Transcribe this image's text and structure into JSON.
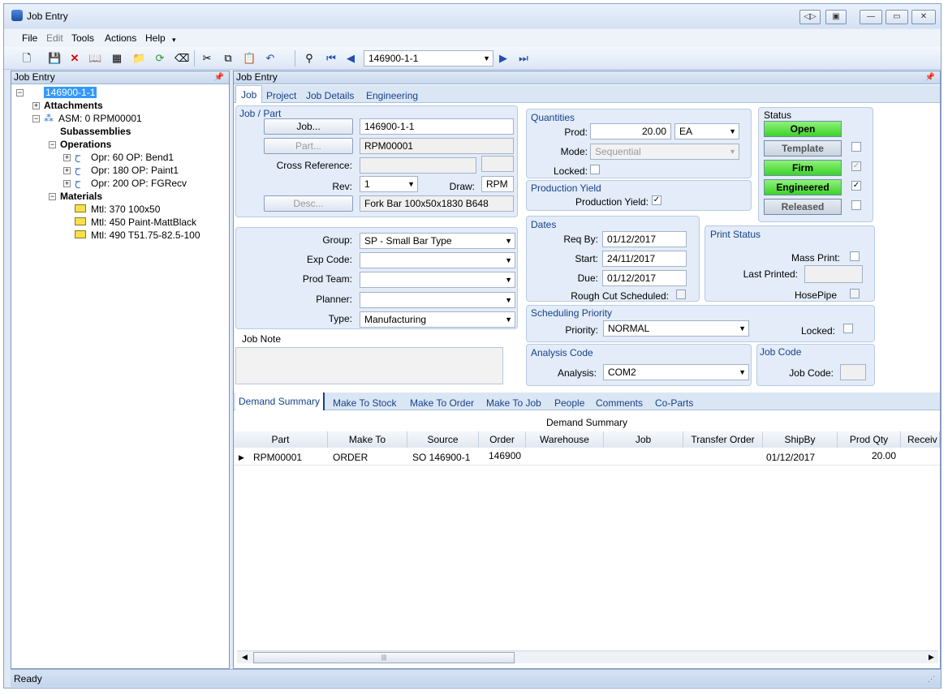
{
  "window": {
    "title": "Job Entry"
  },
  "menu": [
    "File",
    "Edit",
    "Tools",
    "Actions",
    "Help"
  ],
  "toolbar": {
    "job_combo": "146900-1-1"
  },
  "tree_panel": {
    "title": "Job Entry",
    "items": [
      {
        "label": "146900-1-1"
      },
      {
        "label": "Attachments"
      },
      {
        "label": "ASM: 0 RPM00001"
      },
      {
        "label": "Subassemblies"
      },
      {
        "label": "Operations"
      },
      {
        "label": "Opr: 60 OP: Bend1"
      },
      {
        "label": "Opr: 180 OP: Paint1"
      },
      {
        "label": "Opr: 200 OP: FGRecv"
      },
      {
        "label": "Materials"
      },
      {
        "label": "Mtl: 370 100x50"
      },
      {
        "label": "Mtl: 450 Paint-MattBlack"
      },
      {
        "label": "Mtl: 490 T51.75-82.5-100"
      }
    ]
  },
  "main": {
    "title": "Job Entry",
    "tabs": [
      "Job",
      "Project",
      "Job Details",
      "Engineering"
    ]
  },
  "job_part": {
    "title": "Job / Part",
    "job_btn": "Job...",
    "job": "146900-1-1",
    "part_btn": "Part...",
    "part": "RPM00001",
    "cross_ref_label": "Cross Reference:",
    "rev_label": "Rev:",
    "rev": "1",
    "draw_label": "Draw:",
    "draw": "RPM",
    "desc_btn": "Desc...",
    "desc": "Fork Bar 100x50x1830 B648"
  },
  "group_box": {
    "group_label": "Group:",
    "group": "SP - Small Bar Type",
    "exp_label": "Exp Code:",
    "prod_team_label": "Prod Team:",
    "planner_label": "Planner:",
    "type_label": "Type:",
    "type": "Manufacturing"
  },
  "job_note": {
    "label": "Job Note"
  },
  "quantities": {
    "title": "Quantities",
    "prod_label": "Prod:",
    "prod": "20.00",
    "uom": "EA",
    "mode_label": "Mode:",
    "mode": "Sequential",
    "locked_label": "Locked:"
  },
  "production_yield": {
    "title": "Production Yield",
    "label": "Production Yield:"
  },
  "dates": {
    "title": "Dates",
    "req_label": "Req By:",
    "req": "01/12/2017",
    "start_label": "Start:",
    "start": "24/11/2017",
    "due_label": "Due:",
    "due": "01/12/2017",
    "rough_label": "Rough Cut Scheduled:"
  },
  "status": {
    "title": "Status",
    "open": "Open",
    "template": "Template",
    "firm": "Firm",
    "engineered": "Engineered",
    "released": "Released"
  },
  "print_status": {
    "title": "Print Status",
    "mass_label": "Mass Print:",
    "last_label": "Last Printed:",
    "hose_label": "HosePipe"
  },
  "sched": {
    "title": "Scheduling Priority",
    "priority_label": "Priority:",
    "priority": "NORMAL",
    "locked_label": "Locked:"
  },
  "analysis": {
    "title": "Analysis Code",
    "label": "Analysis:",
    "value": "COM2"
  },
  "job_code": {
    "title": "Job Code",
    "label": "Job Code:"
  },
  "bottom_tabs": [
    "Demand Summary",
    "Make To Stock",
    "Make To Order",
    "Make To Job",
    "People",
    "Comments",
    "Co-Parts"
  ],
  "demand": {
    "title": "Demand Summary",
    "columns": [
      "Part",
      "Make To",
      "Source",
      "Order",
      "Warehouse",
      "Job",
      "Transfer Order",
      "ShipBy",
      "Prod Qty",
      "Receiv"
    ],
    "row": {
      "part": "RPM00001",
      "make_to": "ORDER",
      "source": "SO 146900-1",
      "order": "146900",
      "shipby": "01/12/2017",
      "prod_qty": "20.00"
    }
  },
  "statusbar": {
    "text": "Ready"
  }
}
